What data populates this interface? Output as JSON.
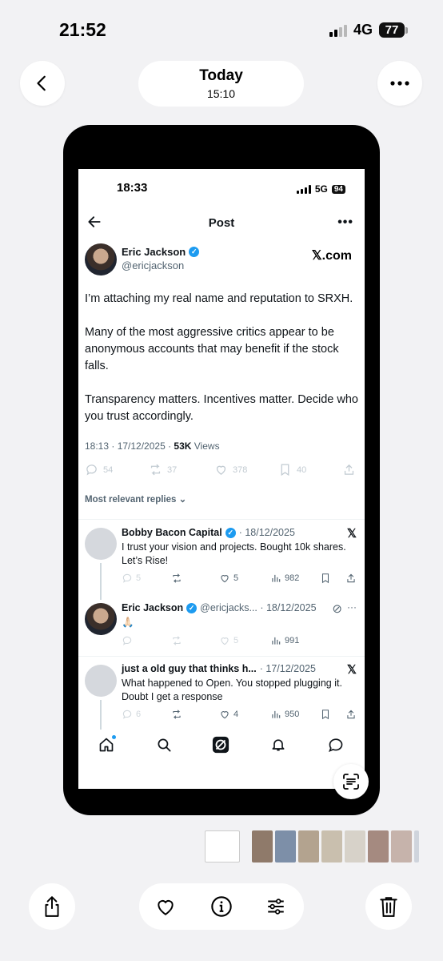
{
  "os_status": {
    "time": "21:52",
    "network": "4G",
    "battery": "77"
  },
  "photo_header": {
    "title": "Today",
    "subtitle": "15:10"
  },
  "inner_status": {
    "time": "18:33",
    "network": "5G",
    "battery": "94"
  },
  "post_header": {
    "title": "Post"
  },
  "author": {
    "name": "Eric Jackson",
    "handle": "@ericjackson",
    "brand": "𝕏.com"
  },
  "post": {
    "paragraphs": [
      "I’m attaching my real name and reputation to SRXH.",
      "Many of the most aggressive critics appear to be anonymous accounts that may benefit if the stock falls.",
      "Transparency matters. Incentives matter. Decide who you trust accordingly."
    ],
    "timestamp": "18:13 · 17/12/2025 · ",
    "views_count": "53K",
    "views_label": " Views",
    "stats": {
      "replies": "54",
      "reposts": "37",
      "likes": "378",
      "bookmarks": "40"
    }
  },
  "replies_filter": "Most relevant replies ⌄",
  "replies": [
    {
      "name": "Bobby Bacon Capital",
      "meta": "· 18/12/2025",
      "text": "I trust your vision and projects.  Bought 10k shares.  Let’s Rise!",
      "replies": "5",
      "likes": "5",
      "views": "982"
    },
    {
      "name": "Eric Jackson",
      "meta": "@ericjacks... · 18/12/2025",
      "text": "🙏🏻",
      "likes": "5",
      "views": "991"
    },
    {
      "name": "just a old guy that thinks h...",
      "meta": "· 17/12/2025",
      "text": "What happened to Open. You stopped plugging it. Doubt I get a response",
      "replies": "6",
      "likes": "4",
      "views": "950"
    }
  ],
  "colors": {
    "accent": "#1d9bf0",
    "text": "#0f1419",
    "muted": "#536471",
    "background": "#f2f2f4"
  }
}
